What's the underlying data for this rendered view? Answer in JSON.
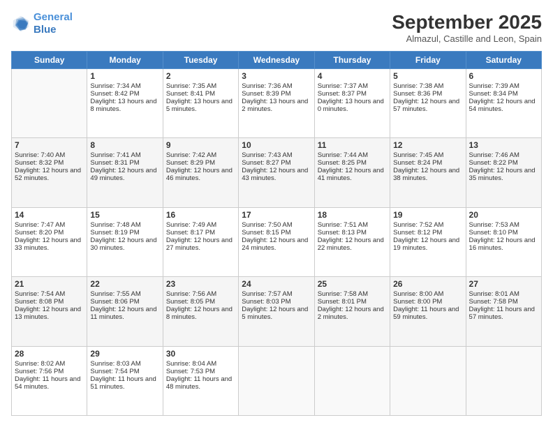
{
  "logo": {
    "line1": "General",
    "line2": "Blue"
  },
  "title": "September 2025",
  "subtitle": "Almazul, Castille and Leon, Spain",
  "weekdays": [
    "Sunday",
    "Monday",
    "Tuesday",
    "Wednesday",
    "Thursday",
    "Friday",
    "Saturday"
  ],
  "weeks": [
    [
      {
        "day": "",
        "info": ""
      },
      {
        "day": "1",
        "sunrise": "Sunrise: 7:34 AM",
        "sunset": "Sunset: 8:42 PM",
        "daylight": "Daylight: 13 hours and 8 minutes."
      },
      {
        "day": "2",
        "sunrise": "Sunrise: 7:35 AM",
        "sunset": "Sunset: 8:41 PM",
        "daylight": "Daylight: 13 hours and 5 minutes."
      },
      {
        "day": "3",
        "sunrise": "Sunrise: 7:36 AM",
        "sunset": "Sunset: 8:39 PM",
        "daylight": "Daylight: 13 hours and 2 minutes."
      },
      {
        "day": "4",
        "sunrise": "Sunrise: 7:37 AM",
        "sunset": "Sunset: 8:37 PM",
        "daylight": "Daylight: 13 hours and 0 minutes."
      },
      {
        "day": "5",
        "sunrise": "Sunrise: 7:38 AM",
        "sunset": "Sunset: 8:36 PM",
        "daylight": "Daylight: 12 hours and 57 minutes."
      },
      {
        "day": "6",
        "sunrise": "Sunrise: 7:39 AM",
        "sunset": "Sunset: 8:34 PM",
        "daylight": "Daylight: 12 hours and 54 minutes."
      }
    ],
    [
      {
        "day": "7",
        "sunrise": "Sunrise: 7:40 AM",
        "sunset": "Sunset: 8:32 PM",
        "daylight": "Daylight: 12 hours and 52 minutes."
      },
      {
        "day": "8",
        "sunrise": "Sunrise: 7:41 AM",
        "sunset": "Sunset: 8:31 PM",
        "daylight": "Daylight: 12 hours and 49 minutes."
      },
      {
        "day": "9",
        "sunrise": "Sunrise: 7:42 AM",
        "sunset": "Sunset: 8:29 PM",
        "daylight": "Daylight: 12 hours and 46 minutes."
      },
      {
        "day": "10",
        "sunrise": "Sunrise: 7:43 AM",
        "sunset": "Sunset: 8:27 PM",
        "daylight": "Daylight: 12 hours and 43 minutes."
      },
      {
        "day": "11",
        "sunrise": "Sunrise: 7:44 AM",
        "sunset": "Sunset: 8:25 PM",
        "daylight": "Daylight: 12 hours and 41 minutes."
      },
      {
        "day": "12",
        "sunrise": "Sunrise: 7:45 AM",
        "sunset": "Sunset: 8:24 PM",
        "daylight": "Daylight: 12 hours and 38 minutes."
      },
      {
        "day": "13",
        "sunrise": "Sunrise: 7:46 AM",
        "sunset": "Sunset: 8:22 PM",
        "daylight": "Daylight: 12 hours and 35 minutes."
      }
    ],
    [
      {
        "day": "14",
        "sunrise": "Sunrise: 7:47 AM",
        "sunset": "Sunset: 8:20 PM",
        "daylight": "Daylight: 12 hours and 33 minutes."
      },
      {
        "day": "15",
        "sunrise": "Sunrise: 7:48 AM",
        "sunset": "Sunset: 8:19 PM",
        "daylight": "Daylight: 12 hours and 30 minutes."
      },
      {
        "day": "16",
        "sunrise": "Sunrise: 7:49 AM",
        "sunset": "Sunset: 8:17 PM",
        "daylight": "Daylight: 12 hours and 27 minutes."
      },
      {
        "day": "17",
        "sunrise": "Sunrise: 7:50 AM",
        "sunset": "Sunset: 8:15 PM",
        "daylight": "Daylight: 12 hours and 24 minutes."
      },
      {
        "day": "18",
        "sunrise": "Sunrise: 7:51 AM",
        "sunset": "Sunset: 8:13 PM",
        "daylight": "Daylight: 12 hours and 22 minutes."
      },
      {
        "day": "19",
        "sunrise": "Sunrise: 7:52 AM",
        "sunset": "Sunset: 8:12 PM",
        "daylight": "Daylight: 12 hours and 19 minutes."
      },
      {
        "day": "20",
        "sunrise": "Sunrise: 7:53 AM",
        "sunset": "Sunset: 8:10 PM",
        "daylight": "Daylight: 12 hours and 16 minutes."
      }
    ],
    [
      {
        "day": "21",
        "sunrise": "Sunrise: 7:54 AM",
        "sunset": "Sunset: 8:08 PM",
        "daylight": "Daylight: 12 hours and 13 minutes."
      },
      {
        "day": "22",
        "sunrise": "Sunrise: 7:55 AM",
        "sunset": "Sunset: 8:06 PM",
        "daylight": "Daylight: 12 hours and 11 minutes."
      },
      {
        "day": "23",
        "sunrise": "Sunrise: 7:56 AM",
        "sunset": "Sunset: 8:05 PM",
        "daylight": "Daylight: 12 hours and 8 minutes."
      },
      {
        "day": "24",
        "sunrise": "Sunrise: 7:57 AM",
        "sunset": "Sunset: 8:03 PM",
        "daylight": "Daylight: 12 hours and 5 minutes."
      },
      {
        "day": "25",
        "sunrise": "Sunrise: 7:58 AM",
        "sunset": "Sunset: 8:01 PM",
        "daylight": "Daylight: 12 hours and 2 minutes."
      },
      {
        "day": "26",
        "sunrise": "Sunrise: 8:00 AM",
        "sunset": "Sunset: 8:00 PM",
        "daylight": "Daylight: 11 hours and 59 minutes."
      },
      {
        "day": "27",
        "sunrise": "Sunrise: 8:01 AM",
        "sunset": "Sunset: 7:58 PM",
        "daylight": "Daylight: 11 hours and 57 minutes."
      }
    ],
    [
      {
        "day": "28",
        "sunrise": "Sunrise: 8:02 AM",
        "sunset": "Sunset: 7:56 PM",
        "daylight": "Daylight: 11 hours and 54 minutes."
      },
      {
        "day": "29",
        "sunrise": "Sunrise: 8:03 AM",
        "sunset": "Sunset: 7:54 PM",
        "daylight": "Daylight: 11 hours and 51 minutes."
      },
      {
        "day": "30",
        "sunrise": "Sunrise: 8:04 AM",
        "sunset": "Sunset: 7:53 PM",
        "daylight": "Daylight: 11 hours and 48 minutes."
      },
      {
        "day": "",
        "info": ""
      },
      {
        "day": "",
        "info": ""
      },
      {
        "day": "",
        "info": ""
      },
      {
        "day": "",
        "info": ""
      }
    ]
  ]
}
